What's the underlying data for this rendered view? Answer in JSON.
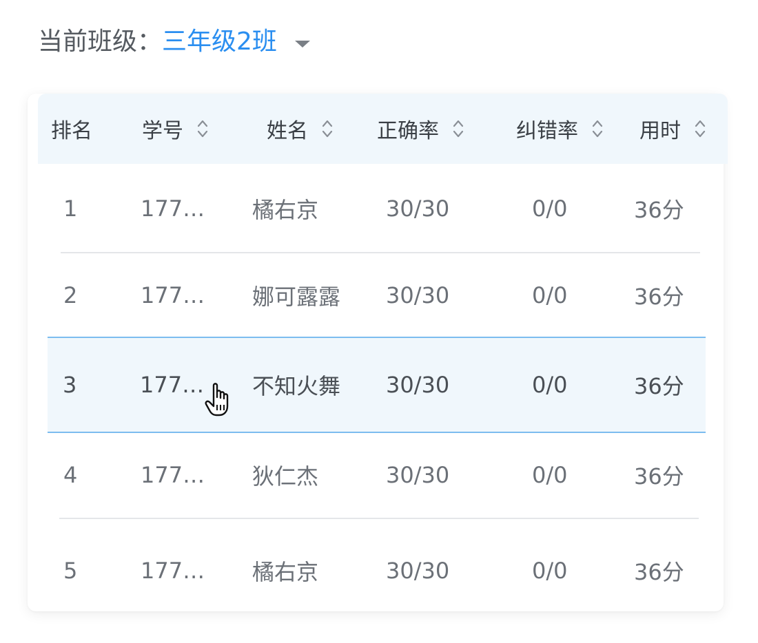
{
  "class_selector": {
    "label": "当前班级：",
    "value": "三年级2班",
    "caret_icon": "caret-down-icon"
  },
  "table": {
    "columns": [
      {
        "key": "rank",
        "label": "排名",
        "sortable": false
      },
      {
        "key": "student_id",
        "label": "学号",
        "sortable": true
      },
      {
        "key": "name",
        "label": "姓名",
        "sortable": true
      },
      {
        "key": "accuracy",
        "label": "正确率",
        "sortable": true
      },
      {
        "key": "correction",
        "label": "纠错率",
        "sortable": true
      },
      {
        "key": "time",
        "label": "用时",
        "sortable": true
      }
    ],
    "rows": [
      {
        "rank": "1",
        "student_id": "177…",
        "name": "橘右京",
        "accuracy": "30/30",
        "correction": "0/0",
        "time": "36分"
      },
      {
        "rank": "2",
        "student_id": "177…",
        "name": "娜可露露",
        "accuracy": "30/30",
        "correction": "0/0",
        "time": "36分"
      },
      {
        "rank": "3",
        "student_id": "177…",
        "name": "不知火舞",
        "accuracy": "30/30",
        "correction": "0/0",
        "time": "36分"
      },
      {
        "rank": "4",
        "student_id": "177…",
        "name": "狄仁杰",
        "accuracy": "30/30",
        "correction": "0/0",
        "time": "36分"
      },
      {
        "rank": "5",
        "student_id": "177…",
        "name": "橘右京",
        "accuracy": "30/30",
        "correction": "0/0",
        "time": "36分"
      }
    ],
    "hovered_row": 2
  },
  "colors": {
    "accent": "#2a8ef0",
    "header_bg": "#f0f7fc",
    "hover_border": "#7cbcef",
    "text_primary": "#3a3f45",
    "text_secondary": "#6b7077",
    "divider": "#e4e6e9"
  },
  "cursor": "hand-pointer-icon"
}
